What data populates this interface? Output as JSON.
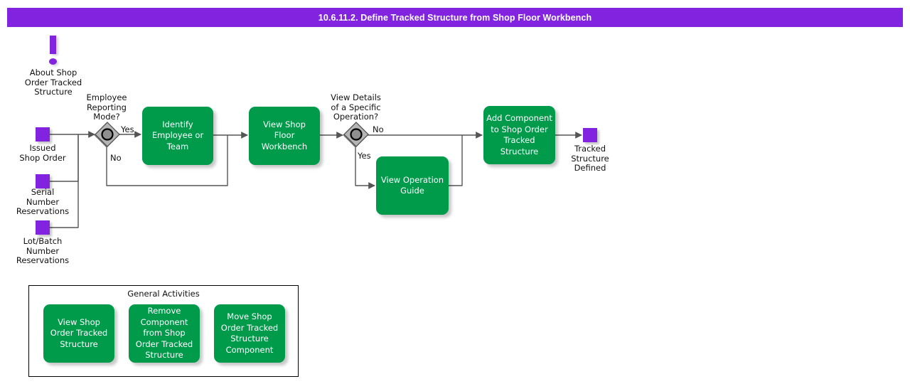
{
  "header": {
    "title": "10.6.11.2. Define Tracked Structure from Shop Floor Workbench",
    "background_color": "#8223E0",
    "text_color": "#ffffff"
  },
  "colors": {
    "task_green": "#009A4B",
    "event_purple": "#8223E0",
    "gateway_gray": "#808080",
    "connector": "#555555",
    "panel_border": "#000000"
  },
  "info_marker": {
    "icon": "exclamation-icon",
    "label": "About Shop\nOrder Tracked\nStructure"
  },
  "start_events": [
    {
      "icon": "event-square-icon",
      "label": "Issued\nShop Order"
    },
    {
      "icon": "event-square-icon",
      "label": "Serial\nNumber\nReservations"
    },
    {
      "icon": "event-square-icon",
      "label": "Lot/Batch\nNumber\nReservations"
    }
  ],
  "end_event": {
    "icon": "event-square-icon",
    "label": "Tracked\nStructure\nDefined"
  },
  "gateways": [
    {
      "id": "employee-reporting-mode",
      "icon": "gateway-diamond-icon",
      "label": "Employee\nReporting\nMode?"
    },
    {
      "id": "view-details-specific-operation",
      "icon": "gateway-diamond-icon",
      "label": "View Details\nof a Specific\nOperation?"
    }
  ],
  "tasks": [
    {
      "id": "identify-employee-or-team",
      "label": "Identify\nEmployee or\nTeam"
    },
    {
      "id": "view-shop-floor-workbench",
      "label": "View Shop Floor\nWorkbench"
    },
    {
      "id": "view-operation-guide",
      "label": "View Operation\nGuide"
    },
    {
      "id": "add-component-to-shop-order-tracked-structure",
      "label": "Add Component\nto Shop Order\nTracked\nStructure"
    }
  ],
  "flow_labels": {
    "employee_yes": "Yes",
    "employee_no": "No",
    "details_no": "No",
    "details_yes": "Yes"
  },
  "general_activities": {
    "title": "General Activities",
    "items": [
      {
        "id": "view-shop-order-tracked-structure",
        "label": "View Shop Order\nTracked\nStructure"
      },
      {
        "id": "remove-component-from-shop-order-tracked-structure",
        "label": "Remove\nComponent\nfrom Shop\nOrder Tracked\nStructure"
      },
      {
        "id": "move-shop-order-tracked-structure-component",
        "label": "Move Shop\nOrder Tracked\nStructure\nComponent"
      }
    ]
  }
}
